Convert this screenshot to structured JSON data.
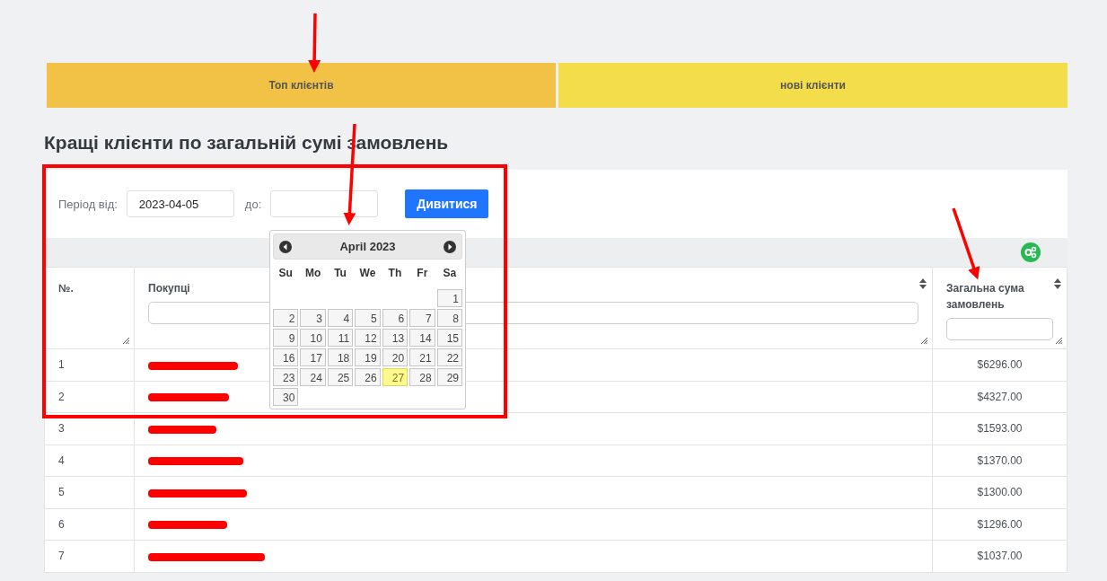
{
  "tabs": [
    {
      "label": "Топ клієнтів",
      "selected": true
    },
    {
      "label": "нові клієнти",
      "selected": false
    }
  ],
  "heading": "Кращі клієнти по загальній сумі замовлень",
  "filter": {
    "from_label": "Період від:",
    "from_value": "2023-04-05",
    "to_label": "до:",
    "button": "Дивитися"
  },
  "datepicker": {
    "title": "April 2023",
    "weekdays": [
      "Su",
      "Mo",
      "Tu",
      "We",
      "Th",
      "Fr",
      "Sa"
    ],
    "weeks": [
      [
        {
          "day": "1",
          "today": false
        }
      ],
      [
        {
          "day": "2",
          "today": false
        },
        {
          "day": "3",
          "today": false
        },
        {
          "day": "4",
          "today": false
        },
        {
          "day": "5",
          "today": false
        },
        {
          "day": "6",
          "today": false
        },
        {
          "day": "7",
          "today": false
        },
        {
          "day": "8",
          "today": false
        }
      ],
      [
        {
          "day": "9",
          "today": false
        },
        {
          "day": "10",
          "today": false
        },
        {
          "day": "11",
          "today": false
        },
        {
          "day": "12",
          "today": false
        },
        {
          "day": "13",
          "today": false
        },
        {
          "day": "14",
          "today": false
        },
        {
          "day": "15",
          "today": false
        }
      ],
      [
        {
          "day": "16",
          "today": false
        },
        {
          "day": "17",
          "today": false
        },
        {
          "day": "18",
          "today": false
        },
        {
          "day": "19",
          "today": false
        },
        {
          "day": "20",
          "today": false
        },
        {
          "day": "21",
          "today": false
        },
        {
          "day": "22",
          "today": false
        }
      ],
      [
        {
          "day": "23",
          "today": false
        },
        {
          "day": "24",
          "today": false
        },
        {
          "day": "25",
          "today": false
        },
        {
          "day": "26",
          "today": false
        },
        {
          "day": "27",
          "today": true
        },
        {
          "day": "28",
          "today": false
        },
        {
          "day": "29",
          "today": false
        }
      ],
      [
        {
          "day": "30",
          "today": false
        }
      ]
    ]
  },
  "table": {
    "columns": [
      {
        "label": "№.",
        "sortable": false,
        "filter": false
      },
      {
        "label": "Покупці",
        "sortable": true,
        "filter": true
      },
      {
        "label": "Загальна сума замовлень",
        "sortable": true,
        "filter": true
      }
    ],
    "rows": [
      {
        "no": "1",
        "customer_redacted": true,
        "total": "$6296.00"
      },
      {
        "no": "2",
        "customer_redacted": true,
        "total": "$4327.00"
      },
      {
        "no": "3",
        "customer_redacted": true,
        "total": "$1593.00"
      },
      {
        "no": "4",
        "customer_redacted": true,
        "total": "$1370.00"
      },
      {
        "no": "5",
        "customer_redacted": true,
        "total": "$1300.00"
      },
      {
        "no": "6",
        "customer_redacted": true,
        "total": "$1296.00"
      },
      {
        "no": "7",
        "customer_redacted": true,
        "total": "$1037.00"
      }
    ]
  }
}
